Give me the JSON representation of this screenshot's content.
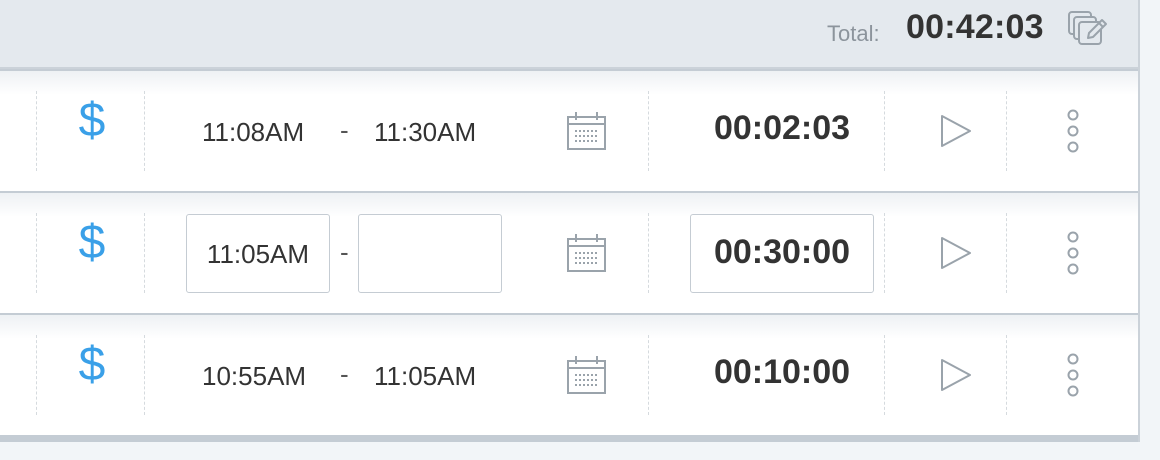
{
  "header": {
    "total_label": "Total:",
    "total_value": "00:42:03",
    "bulk_edit_icon": "bulk-edit-icon"
  },
  "colors": {
    "billable": "#3aa0e8",
    "text": "#333333",
    "header_bg": "#e4e9ee"
  },
  "entries": [
    {
      "billable_symbol": "$",
      "start": "11:08AM",
      "separator": "-",
      "end": "11:30AM",
      "duration": "00:02:03",
      "editing": false
    },
    {
      "billable_symbol": "$",
      "start": "11:05AM",
      "separator": "-",
      "end": "",
      "duration": "00:30:00",
      "editing": true
    },
    {
      "billable_symbol": "$",
      "start": "10:55AM",
      "separator": "-",
      "end": "11:05AM",
      "duration": "00:10:00",
      "editing": false
    }
  ]
}
